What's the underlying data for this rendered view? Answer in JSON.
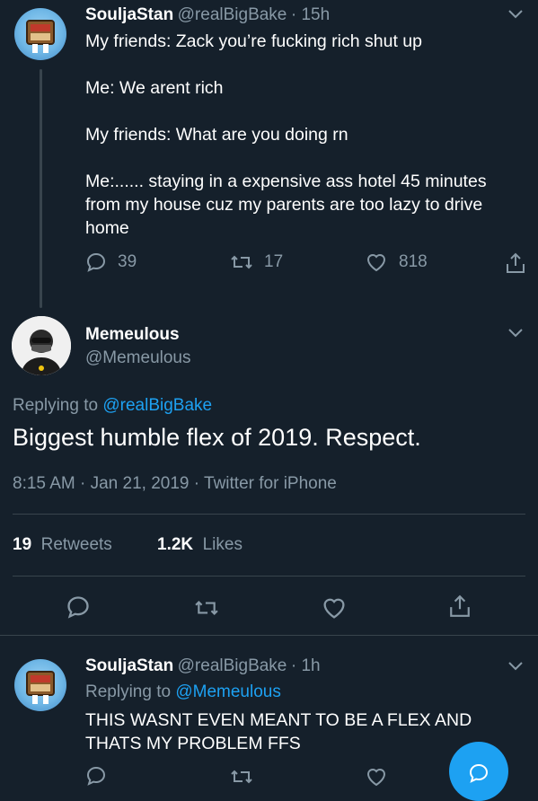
{
  "tweet1": {
    "name": "SouljaStan",
    "handle": "@realBigBake",
    "time": "· 15h",
    "lines": [
      "My friends: Zack you’re fucking rich shut up",
      "Me: We arent rich",
      "My friends: What are you doing rn",
      "Me:...... staying in a expensive ass hotel 45 minutes from my house cuz my parents are too lazy to drive home"
    ],
    "replies": "39",
    "retweets": "17",
    "likes": "818"
  },
  "focus": {
    "name": "Memeulous",
    "handle": "@Memeulous",
    "replying_prefix": "Replying to",
    "replying_handle": "@realBigBake",
    "text": "Biggest humble flex of 2019. Respect.",
    "timestamp": "8:15 AM · Jan 21, 2019 · Twitter for iPhone",
    "retweets_count": "19",
    "retweets_label": "Retweets",
    "likes_count": "1.2K",
    "likes_label": "Likes"
  },
  "tweet3": {
    "name": "SouljaStan",
    "handle": "@realBigBake",
    "time": "· 1h",
    "replying_prefix": "Replying to",
    "replying_handle": "@Memeulous",
    "text": "THIS WASNT EVEN MEANT TO BE A FLEX AND THATS MY PROBLEM FFS"
  },
  "colors": {
    "background": "#15202b",
    "muted": "#8899a6",
    "accent": "#1da1f2",
    "divider": "#38444d"
  }
}
